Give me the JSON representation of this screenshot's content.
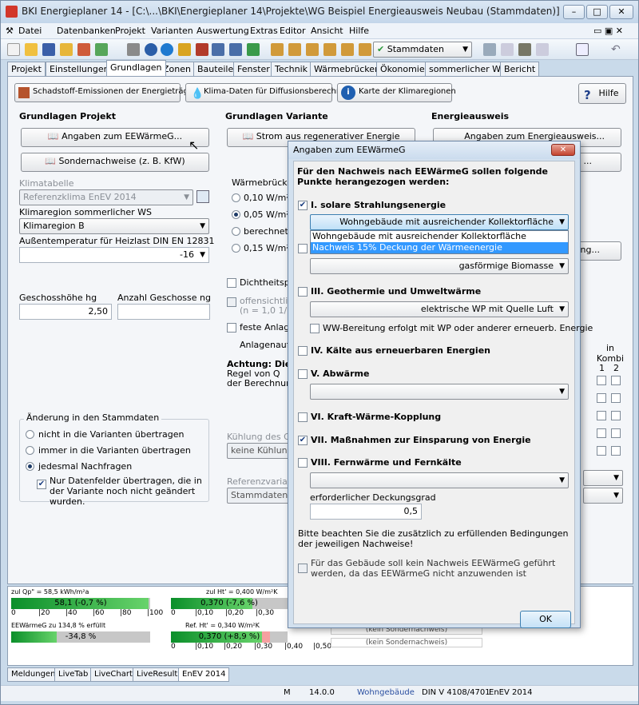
{
  "window": {
    "title": "BKI Energieplaner 14 - [C:\\...\\BKI\\Energieplaner 14\\Projekte\\WG Beispiel Energieausweis Neubau (Stammdaten)]"
  },
  "menu": [
    "Datei",
    "Datenbanken",
    "Projekt",
    "Varianten",
    "Auswertung",
    "Extras",
    "Editor",
    "Ansicht",
    "Hilfe"
  ],
  "toolbar": {
    "variant_select": "Stammdaten"
  },
  "tabs": [
    "Projekt",
    "Einstellungen",
    "Grundlagen",
    "Zonen",
    "Bauteile",
    "Fenster",
    "Technik",
    "Wärmebrücken",
    "Ökonomie",
    "sommerlicher WS",
    "Bericht"
  ],
  "actions": {
    "emissions": "Schadstoff-Emissionen der Energieträger",
    "climate": "Klima-Daten für Diffusionsberechnung",
    "map": "Karte der Klimaregionen",
    "help": "Hilfe"
  },
  "project": {
    "title": "Grundlagen Projekt",
    "eewg_btn": "Angaben zum EEWärmeG...",
    "special_btn": "Sondernachweise (z. B. KfW)",
    "klima_label": "Klimatabelle",
    "klima_value": "Referenzklima EnEV 2014",
    "region_label": "Klimaregion sommerlicher WS",
    "region_value": "Klimaregion B",
    "temp_label": "Außentemperatur für Heizlast DIN EN 12831",
    "temp_value": "-16",
    "storey_h_label": "Geschosshöhe hg",
    "storey_h_value": "2,50",
    "storey_n_label": "Anzahl Geschosse ng",
    "storey_n_value": ""
  },
  "changes": {
    "title": "Änderung in den Stammdaten",
    "opt1": "nicht in die Varianten übertragen",
    "opt2": "immer in die Varianten übertragen",
    "opt3": "jedesmal Nachfragen",
    "only": "Nur Datenfelder übertragen, die in der Variante noch nicht geändert wurden."
  },
  "variant": {
    "title": "Grundlagen Variante",
    "power_btn": "Strom aus regenerativer Energie",
    "wb_label": "Wärmebrücke",
    "wb1": "0,10 W/m²",
    "wb2": "0,05 W/m²",
    "wb3": "berechnet n",
    "wb4": "0,15 W/m²",
    "density": "Dichtheitsprü",
    "offen1": "offensichtlich",
    "offen2": "(n = 1,0 1/h",
    "feste": "feste Anlagen",
    "anlagen": "Anlagenaufw",
    "achtung1": "Achtung: Die A",
    "achtung2": "Regel von Q",
    "achtung3": "der Berechnung",
    "cool_label": "Kühlung des Ge",
    "cool_value": "keine Kühlung",
    "ref_label": "Referenzvariante",
    "ref_value": "Stammdaten"
  },
  "energy": {
    "title": "Energieausweis",
    "btn1": "Angaben zum Energieausweis...",
    "btn2": "...",
    "btn3": "ng...",
    "kombi": "in Kombi",
    "k1": "1",
    "k2": "2"
  },
  "dialog": {
    "title": "Angaben zum EEWärmeG",
    "intro": "Für den Nachweis nach EEWärmeG sollen folgende Punkte herangezogen werden:",
    "i_label": "I. solare Strahlungsenergie",
    "i_value": "Wohngebäude mit ausreichender Kollektorfläche",
    "i_options": [
      "Wohngebäude mit ausreichender Kollektorfläche",
      "Nachweis 15% Deckung der Wärmeenergie"
    ],
    "ii_value": "gasförmige Biomasse",
    "iii_label": "III. Geothermie und Umweltwärme",
    "iii_value": "elektrische WP mit Quelle Luft",
    "iii_ww": "WW-Bereitung erfolgt mit WP oder anderer erneuerb. Energie",
    "iv_label": "IV. Kälte aus erneuerbaren Energien",
    "v_label": "V. Abwärme",
    "vi_label": "VI. Kraft-Wärme-Kopplung",
    "vii_label": "VII. Maßnahmen zur Einsparung von Energie",
    "viii_label": "VIII. Fernwärme und Fernkälte",
    "deckung_label": "erforderlicher Deckungsgrad",
    "deckung_value": "0,5",
    "note": "Bitte beachten Sie die zusätzlich zu erfüllenden Bedingungen der jeweiligen Nachweise!",
    "none": "Für das Gebäude soll kein Nachweis EEWärmeG geführt werden, da das EEWärmeG nicht anzuwenden ist",
    "ok": "OK"
  },
  "results": {
    "qp_label": "zul Qp\" = 58,5 kWh/m²a",
    "qp_bar": "58,1 (-0,7 %)",
    "qp_fill": 0.99,
    "scale1": [
      "0",
      "|20",
      "|40",
      "|60",
      "|80",
      "|100"
    ],
    "ht_label": "zul Ht' = 0,400 W/m²K",
    "ht_bar": "0,370 (-7,6 %)",
    "ht_fill": 0.7,
    "scale2": [
      "0",
      "|0,10",
      "|0,20",
      "|0,30"
    ],
    "eewg_label": "EEWärmeG zu 134,8 % erfüllt",
    "eewg_bar": "-34,8 %",
    "eewg_fill": 0.33,
    "ref_label": "Ref. Ht' = 0,340 W/m²K",
    "ref_bar": "0,370 (+8,9 %)",
    "ref_fill": 0.78,
    "scale3": [
      "0",
      "|0,10",
      "|0,20",
      "|0,30",
      "|0,40",
      "|0,50"
    ],
    "kein1": "(kein Sondernachweis)",
    "kein2": "(kein Sondernachweis)"
  },
  "bottom_tabs": [
    "Meldungen",
    "LiveTab",
    "LiveChart",
    "LiveResults",
    "EnEV 2014"
  ],
  "status": {
    "m": "M",
    "version": "14.0.0",
    "type": "Wohngebäude",
    "din": "DIN V 4108/4701",
    "enev": "EnEV 2014"
  },
  "colors": {
    "accent": "#3399ff",
    "bar_green": "#0b8f2a",
    "bar_grey": "#c7c7c7"
  }
}
